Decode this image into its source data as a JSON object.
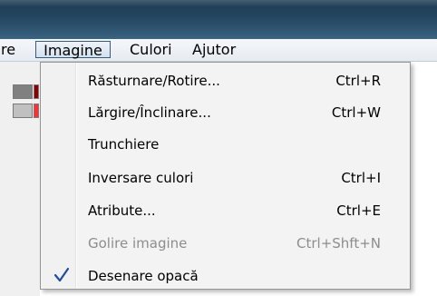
{
  "menubar": {
    "partial_item": "re",
    "items": [
      {
        "label": "Imagine"
      },
      {
        "label": "Culori"
      },
      {
        "label": "Ajutor"
      }
    ]
  },
  "dropdown": {
    "items": [
      {
        "label": "Răsturnare/Rotire...",
        "shortcut": "Ctrl+R",
        "enabled": true,
        "checked": false
      },
      {
        "label": "Lărgire/Înclinare...",
        "shortcut": "Ctrl+W",
        "enabled": true,
        "checked": false
      },
      {
        "label": "Trunchiere",
        "shortcut": "",
        "enabled": true,
        "checked": false
      },
      {
        "label": "Inversare culori",
        "shortcut": "Ctrl+I",
        "enabled": true,
        "checked": false
      },
      {
        "label": "Atribute...",
        "shortcut": "Ctrl+E",
        "enabled": true,
        "checked": false
      },
      {
        "label": "Golire imagine",
        "shortcut": "Ctrl+Shft+N",
        "enabled": false,
        "checked": false
      },
      {
        "label": "Desenare opacă",
        "shortcut": "",
        "enabled": true,
        "checked": true
      }
    ]
  },
  "colors": {
    "titlebar": "#24445e",
    "check": "#1f4e9e",
    "disabled_text": "#8d8d8d",
    "menu_background": "#f3f3f3"
  },
  "icons": {
    "check": "checkmark-icon"
  }
}
